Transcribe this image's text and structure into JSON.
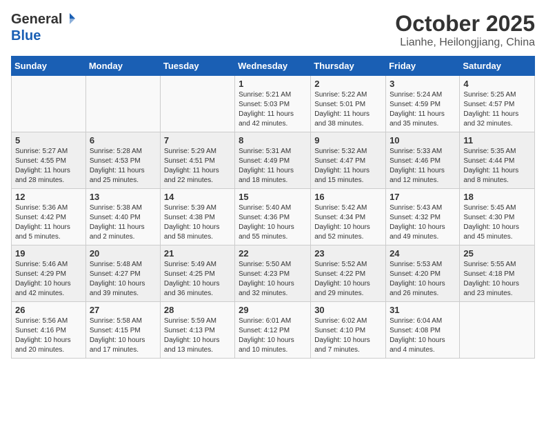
{
  "header": {
    "logo_general": "General",
    "logo_blue": "Blue",
    "month": "October 2025",
    "location": "Lianhe, Heilongjiang, China"
  },
  "weekdays": [
    "Sunday",
    "Monday",
    "Tuesday",
    "Wednesday",
    "Thursday",
    "Friday",
    "Saturday"
  ],
  "weeks": [
    [
      {
        "day": "",
        "info": ""
      },
      {
        "day": "",
        "info": ""
      },
      {
        "day": "",
        "info": ""
      },
      {
        "day": "1",
        "info": "Sunrise: 5:21 AM\nSunset: 5:03 PM\nDaylight: 11 hours\nand 42 minutes."
      },
      {
        "day": "2",
        "info": "Sunrise: 5:22 AM\nSunset: 5:01 PM\nDaylight: 11 hours\nand 38 minutes."
      },
      {
        "day": "3",
        "info": "Sunrise: 5:24 AM\nSunset: 4:59 PM\nDaylight: 11 hours\nand 35 minutes."
      },
      {
        "day": "4",
        "info": "Sunrise: 5:25 AM\nSunset: 4:57 PM\nDaylight: 11 hours\nand 32 minutes."
      }
    ],
    [
      {
        "day": "5",
        "info": "Sunrise: 5:27 AM\nSunset: 4:55 PM\nDaylight: 11 hours\nand 28 minutes."
      },
      {
        "day": "6",
        "info": "Sunrise: 5:28 AM\nSunset: 4:53 PM\nDaylight: 11 hours\nand 25 minutes."
      },
      {
        "day": "7",
        "info": "Sunrise: 5:29 AM\nSunset: 4:51 PM\nDaylight: 11 hours\nand 22 minutes."
      },
      {
        "day": "8",
        "info": "Sunrise: 5:31 AM\nSunset: 4:49 PM\nDaylight: 11 hours\nand 18 minutes."
      },
      {
        "day": "9",
        "info": "Sunrise: 5:32 AM\nSunset: 4:47 PM\nDaylight: 11 hours\nand 15 minutes."
      },
      {
        "day": "10",
        "info": "Sunrise: 5:33 AM\nSunset: 4:46 PM\nDaylight: 11 hours\nand 12 minutes."
      },
      {
        "day": "11",
        "info": "Sunrise: 5:35 AM\nSunset: 4:44 PM\nDaylight: 11 hours\nand 8 minutes."
      }
    ],
    [
      {
        "day": "12",
        "info": "Sunrise: 5:36 AM\nSunset: 4:42 PM\nDaylight: 11 hours\nand 5 minutes."
      },
      {
        "day": "13",
        "info": "Sunrise: 5:38 AM\nSunset: 4:40 PM\nDaylight: 11 hours\nand 2 minutes."
      },
      {
        "day": "14",
        "info": "Sunrise: 5:39 AM\nSunset: 4:38 PM\nDaylight: 10 hours\nand 58 minutes."
      },
      {
        "day": "15",
        "info": "Sunrise: 5:40 AM\nSunset: 4:36 PM\nDaylight: 10 hours\nand 55 minutes."
      },
      {
        "day": "16",
        "info": "Sunrise: 5:42 AM\nSunset: 4:34 PM\nDaylight: 10 hours\nand 52 minutes."
      },
      {
        "day": "17",
        "info": "Sunrise: 5:43 AM\nSunset: 4:32 PM\nDaylight: 10 hours\nand 49 minutes."
      },
      {
        "day": "18",
        "info": "Sunrise: 5:45 AM\nSunset: 4:30 PM\nDaylight: 10 hours\nand 45 minutes."
      }
    ],
    [
      {
        "day": "19",
        "info": "Sunrise: 5:46 AM\nSunset: 4:29 PM\nDaylight: 10 hours\nand 42 minutes."
      },
      {
        "day": "20",
        "info": "Sunrise: 5:48 AM\nSunset: 4:27 PM\nDaylight: 10 hours\nand 39 minutes."
      },
      {
        "day": "21",
        "info": "Sunrise: 5:49 AM\nSunset: 4:25 PM\nDaylight: 10 hours\nand 36 minutes."
      },
      {
        "day": "22",
        "info": "Sunrise: 5:50 AM\nSunset: 4:23 PM\nDaylight: 10 hours\nand 32 minutes."
      },
      {
        "day": "23",
        "info": "Sunrise: 5:52 AM\nSunset: 4:22 PM\nDaylight: 10 hours\nand 29 minutes."
      },
      {
        "day": "24",
        "info": "Sunrise: 5:53 AM\nSunset: 4:20 PM\nDaylight: 10 hours\nand 26 minutes."
      },
      {
        "day": "25",
        "info": "Sunrise: 5:55 AM\nSunset: 4:18 PM\nDaylight: 10 hours\nand 23 minutes."
      }
    ],
    [
      {
        "day": "26",
        "info": "Sunrise: 5:56 AM\nSunset: 4:16 PM\nDaylight: 10 hours\nand 20 minutes."
      },
      {
        "day": "27",
        "info": "Sunrise: 5:58 AM\nSunset: 4:15 PM\nDaylight: 10 hours\nand 17 minutes."
      },
      {
        "day": "28",
        "info": "Sunrise: 5:59 AM\nSunset: 4:13 PM\nDaylight: 10 hours\nand 13 minutes."
      },
      {
        "day": "29",
        "info": "Sunrise: 6:01 AM\nSunset: 4:12 PM\nDaylight: 10 hours\nand 10 minutes."
      },
      {
        "day": "30",
        "info": "Sunrise: 6:02 AM\nSunset: 4:10 PM\nDaylight: 10 hours\nand 7 minutes."
      },
      {
        "day": "31",
        "info": "Sunrise: 6:04 AM\nSunset: 4:08 PM\nDaylight: 10 hours\nand 4 minutes."
      },
      {
        "day": "",
        "info": ""
      }
    ]
  ]
}
